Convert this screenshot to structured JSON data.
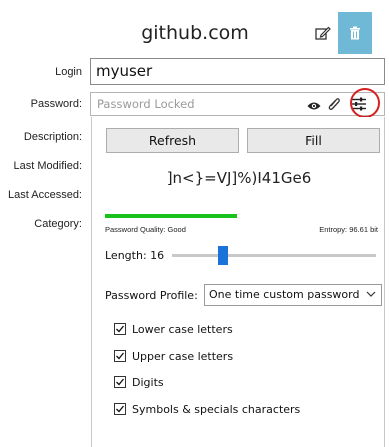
{
  "header": {
    "title": "github.com",
    "edit_icon": "pencil-edit-icon",
    "delete_icon": "trash-icon",
    "accent": "#6fb8d6"
  },
  "labels": {
    "login": "Login",
    "password": "Password:",
    "description": "Description:",
    "last_modified": "Last Modified:",
    "last_accessed": "Last Accessed:",
    "category": "Category:"
  },
  "login": {
    "value": "myuser"
  },
  "password": {
    "placeholder": "Password Locked",
    "icons": [
      "eye-icon",
      "paperclip-icon",
      "sliders-icon"
    ],
    "highlight_color": "#d62020"
  },
  "generator": {
    "refresh_label": "Refresh",
    "fill_label": "Fill",
    "generated_password": "]n<}=VJ]%)I41Ge6",
    "quality_label": "Password Quality: Good",
    "quality_fraction": 0.45,
    "quality_color": "#19c11c",
    "entropy_label": "Entropy: 96.61 bit",
    "length_label": "Length: 16",
    "length_value": 16,
    "profile_label": "Password Profile:",
    "profile_value": "One time custom password",
    "options": [
      {
        "label": "Lower case letters",
        "checked": true
      },
      {
        "label": "Upper case letters",
        "checked": true
      },
      {
        "label": "Digits",
        "checked": true
      },
      {
        "label": "Symbols & specials characters",
        "checked": true
      }
    ]
  }
}
